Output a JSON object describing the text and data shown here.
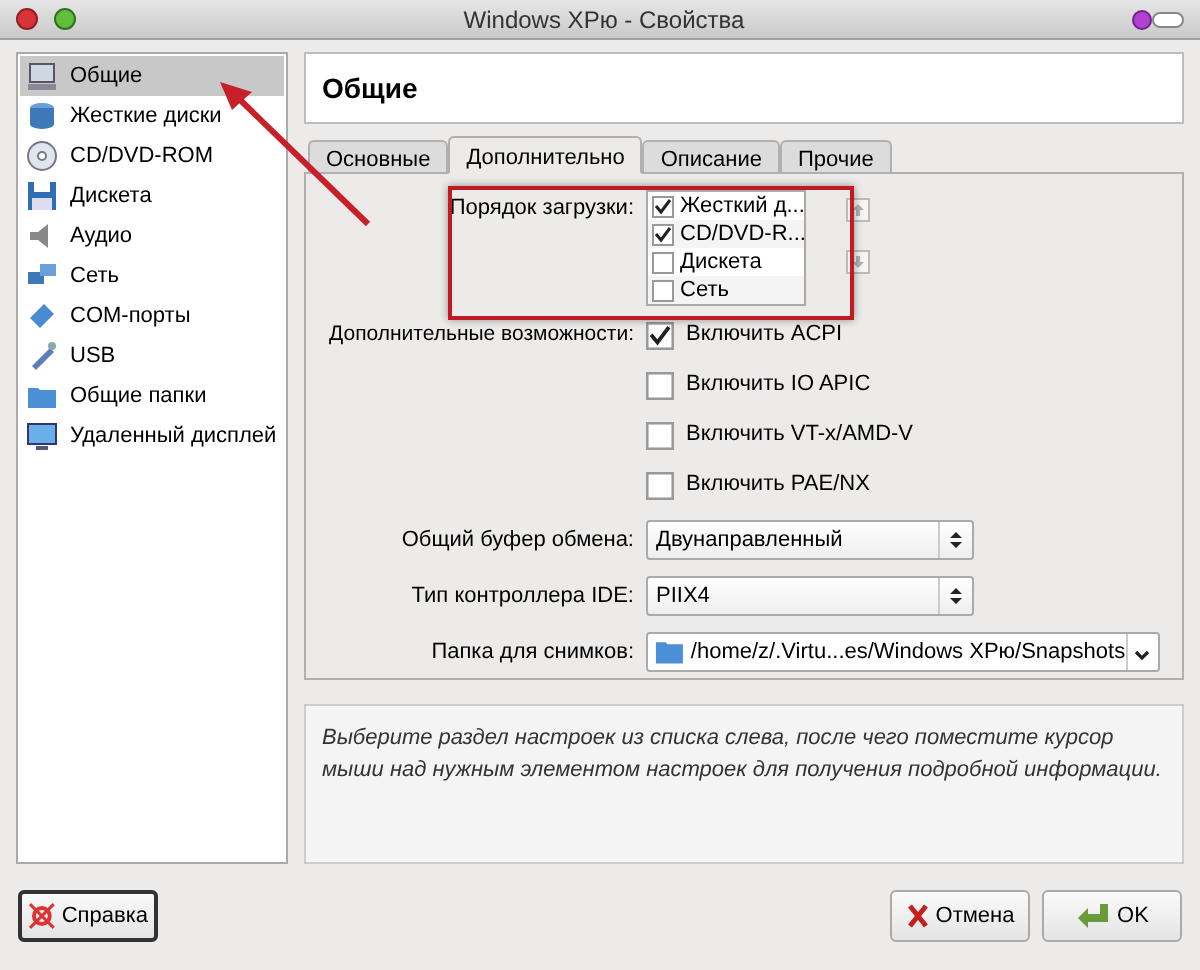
{
  "window": {
    "title": "Windows XPю - Свойства"
  },
  "sidebar": {
    "items": [
      {
        "label": "Общие",
        "selected": true
      },
      {
        "label": "Жесткие диски",
        "selected": false
      },
      {
        "label": "CD/DVD-ROM",
        "selected": false
      },
      {
        "label": "Дискета",
        "selected": false
      },
      {
        "label": "Аудио",
        "selected": false
      },
      {
        "label": "Сеть",
        "selected": false
      },
      {
        "label": "COM-порты",
        "selected": false
      },
      {
        "label": "USB",
        "selected": false
      },
      {
        "label": "Общие папки",
        "selected": false
      },
      {
        "label": "Удаленный дисплей",
        "selected": false
      }
    ]
  },
  "header": {
    "title": "Общие"
  },
  "tabs": [
    {
      "label": "Основные",
      "selected": false
    },
    {
      "label": "Дополнительно",
      "selected": true
    },
    {
      "label": "Описание",
      "selected": false
    },
    {
      "label": "Прочие",
      "selected": false
    }
  ],
  "boot_order": {
    "label": "Порядок загрузки:",
    "items": [
      {
        "label": "Жесткий д...",
        "checked": true
      },
      {
        "label": "CD/DVD-R...",
        "checked": true
      },
      {
        "label": "Дискета",
        "checked": false
      },
      {
        "label": "Сеть",
        "checked": false
      }
    ]
  },
  "features": {
    "label": "Дополнительные возможности:",
    "items": [
      {
        "label": "Включить ACPI",
        "checked": true
      },
      {
        "label": "Включить IO APIC",
        "checked": false
      },
      {
        "label": "Включить VT-x/AMD-V",
        "checked": false
      },
      {
        "label": "Включить PAE/NX",
        "checked": false
      }
    ]
  },
  "selects": [
    {
      "label": "Общий буфер обмена:",
      "value": "Двунаправленный",
      "kind": "spin"
    },
    {
      "label": "Тип контроллера IDE:",
      "value": "PIIX4",
      "kind": "spin"
    },
    {
      "label": "Папка для снимков:",
      "value": "/home/z/.Virtu...es/Windows XPю/Snapshots",
      "kind": "folder"
    }
  ],
  "description": "Выберите раздел настроек из списка слева, после чего поместите курсор мыши над нужным элементом настроек для получения подробной информации.",
  "buttons": [
    {
      "label": "Справка",
      "kind": "help"
    },
    {
      "label": "Отмена",
      "kind": "cancel"
    },
    {
      "label": "OK",
      "kind": "ok"
    }
  ]
}
